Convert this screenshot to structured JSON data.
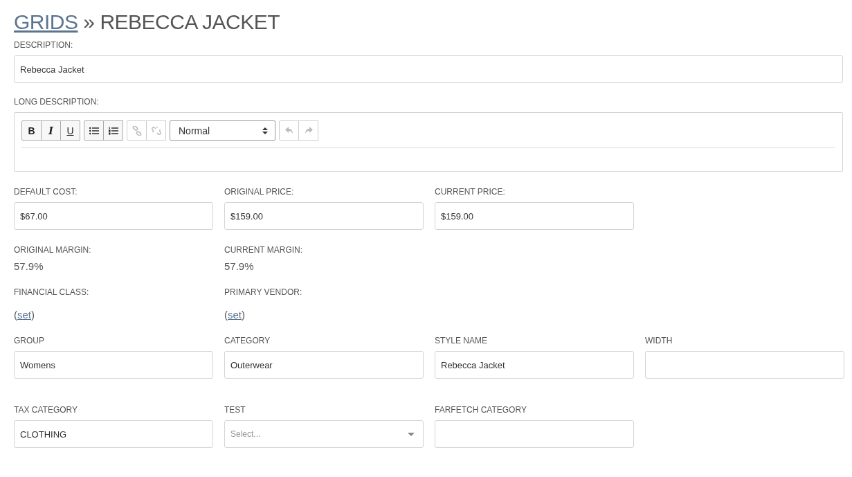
{
  "breadcrumb": {
    "link": "GRIDS",
    "separator": "»",
    "current": "REBECCA JACKET"
  },
  "description": {
    "label": "DESCRIPTION:",
    "value": "Rebecca Jacket"
  },
  "long_description": {
    "label": "LONG DESCRIPTION:",
    "toolbar": [
      [
        {
          "kind": "bold",
          "label": "B",
          "disabled": false
        },
        {
          "kind": "italic",
          "label": "I",
          "disabled": false
        },
        {
          "kind": "underline",
          "label": "U",
          "disabled": false
        }
      ],
      [
        {
          "kind": "bullets",
          "disabled": false
        },
        {
          "kind": "numbers",
          "disabled": false
        }
      ],
      [
        {
          "kind": "link",
          "disabled": true
        },
        {
          "kind": "unlink",
          "disabled": true
        }
      ],
      [
        {
          "kind": "format",
          "value": "Normal"
        }
      ],
      [
        {
          "kind": "undo",
          "disabled": true
        },
        {
          "kind": "redo",
          "disabled": true
        }
      ]
    ]
  },
  "rows": [
    [
      {
        "kind": "text",
        "label": "DEFAULT COST:",
        "value": "$67.00"
      },
      {
        "kind": "text",
        "label": "ORIGINAL PRICE:",
        "value": "$159.00"
      },
      {
        "kind": "text",
        "label": "CURRENT PRICE:",
        "value": "$159.00"
      }
    ],
    [
      {
        "kind": "value",
        "label": "ORIGINAL MARGIN:",
        "value": "57.9%"
      },
      {
        "kind": "value",
        "label": "CURRENT MARGIN:",
        "value": "57.9%"
      }
    ],
    [
      {
        "kind": "link",
        "label": "FINANCIAL CLASS:",
        "open": "(",
        "link": "set",
        "close": ")"
      },
      {
        "kind": "link",
        "label": "PRIMARY VENDOR:",
        "open": "(",
        "link": "set",
        "close": ")"
      }
    ],
    [
      {
        "kind": "text",
        "label": "GROUP",
        "value": "Womens"
      },
      {
        "kind": "text",
        "label": "CATEGORY",
        "value": "Outerwear"
      },
      {
        "kind": "text",
        "label": "STYLE NAME",
        "value": "Rebecca Jacket"
      },
      {
        "kind": "text",
        "label": "WIDTH"
      }
    ],
    [
      {
        "kind": "text",
        "label": "TAX CATEGORY",
        "value": "CLOTHING"
      },
      {
        "kind": "select",
        "label": "TEST",
        "placeholder": "Select..."
      },
      {
        "kind": "text",
        "label": "FARFETCH CATEGORY"
      }
    ]
  ]
}
